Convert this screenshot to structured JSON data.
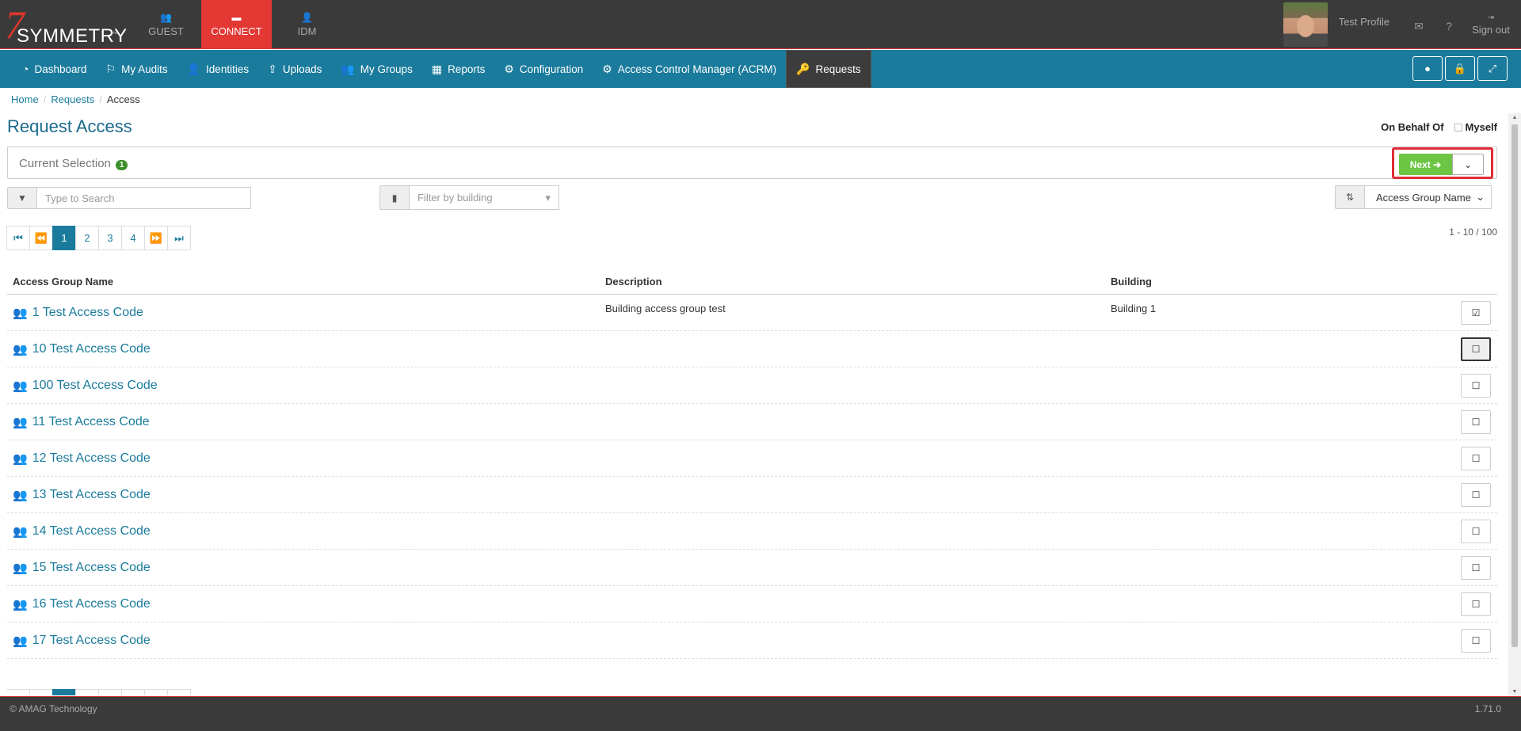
{
  "logo": {
    "seven": "7",
    "brand": "SYMMETRY",
    "tm": "™"
  },
  "apps": [
    {
      "label": "GUEST",
      "icon": "👥"
    },
    {
      "label": "CONNECT",
      "icon": "▬"
    },
    {
      "label": "IDM",
      "icon": "👤"
    }
  ],
  "profile": {
    "name": "Test Profile",
    "signout": "Sign out",
    "signout_icon": "⇥",
    "mail_icon": "✉",
    "help_icon": "?"
  },
  "nav": [
    {
      "label": "Dashboard",
      "icon": "◔"
    },
    {
      "label": "My Audits",
      "icon": "⚐"
    },
    {
      "label": "Identities",
      "icon": "👤"
    },
    {
      "label": "Uploads",
      "icon": "⇪"
    },
    {
      "label": "My Groups",
      "icon": "👥"
    },
    {
      "label": "Reports",
      "icon": "▦"
    },
    {
      "label": "Configuration",
      "icon": "⚙"
    },
    {
      "label": "Access Control Manager (ACRM)",
      "icon": "⚙"
    },
    {
      "label": "Requests",
      "icon": "🔑"
    }
  ],
  "nav_buttons": [
    {
      "icon": "●"
    },
    {
      "icon": "🔒"
    },
    {
      "icon": "⤢"
    }
  ],
  "breadcrumb": {
    "home": "Home",
    "requests": "Requests",
    "current": "Access",
    "sep": "/"
  },
  "page": {
    "title": "Request Access",
    "behalf_label": "On Behalf Of",
    "myself_label": "Myself",
    "selection_label": "Current Selection",
    "selection_count": "1",
    "next_label": "Next ➔",
    "dropdown_icon": "⌄"
  },
  "filters": {
    "search_placeholder": "Type to Search",
    "search_value": "",
    "filter_icon": "▼",
    "building_placeholder": "Filter by building",
    "building_icon": "▮",
    "caret": "▾",
    "sort_icon": "⇅",
    "sort_value": "Access Group Name",
    "sort_caret": "⌄"
  },
  "pagination": {
    "first": "⏮",
    "prev": "⏪",
    "pages": [
      "1",
      "2",
      "3",
      "4"
    ],
    "next": "⏩",
    "last": "⏭",
    "current": "1",
    "range": "1 - 10 / 100"
  },
  "table": {
    "headers": {
      "name": "Access Group Name",
      "description": "Description",
      "building": "Building"
    },
    "rows": [
      {
        "name": "1 Test Access Code",
        "description": "Building access group test",
        "building": "Building 1",
        "checked": true
      },
      {
        "name": "10 Test Access Code",
        "description": "",
        "building": "",
        "checked": false
      },
      {
        "name": "100 Test Access Code",
        "description": "",
        "building": "",
        "checked": false
      },
      {
        "name": "11 Test Access Code",
        "description": "",
        "building": "",
        "checked": false
      },
      {
        "name": "12 Test Access Code",
        "description": "",
        "building": "",
        "checked": false
      },
      {
        "name": "13 Test Access Code",
        "description": "",
        "building": "",
        "checked": false
      },
      {
        "name": "14 Test Access Code",
        "description": "",
        "building": "",
        "checked": false
      },
      {
        "name": "15 Test Access Code",
        "description": "",
        "building": "",
        "checked": false
      },
      {
        "name": "16 Test Access Code",
        "description": "",
        "building": "",
        "checked": false
      },
      {
        "name": "17 Test Access Code",
        "description": "",
        "building": "",
        "checked": false
      }
    ],
    "group_icon": "👥",
    "checked_icon": "☑",
    "unchecked_icon": "☐"
  },
  "footer": {
    "copyright": "© AMAG Technology",
    "version": "1.71.0"
  },
  "colors": {
    "accent": "#1a7b9c",
    "brand_red": "#e33834",
    "next_green": "#6cc644",
    "topbar": "#3a3a3a"
  }
}
